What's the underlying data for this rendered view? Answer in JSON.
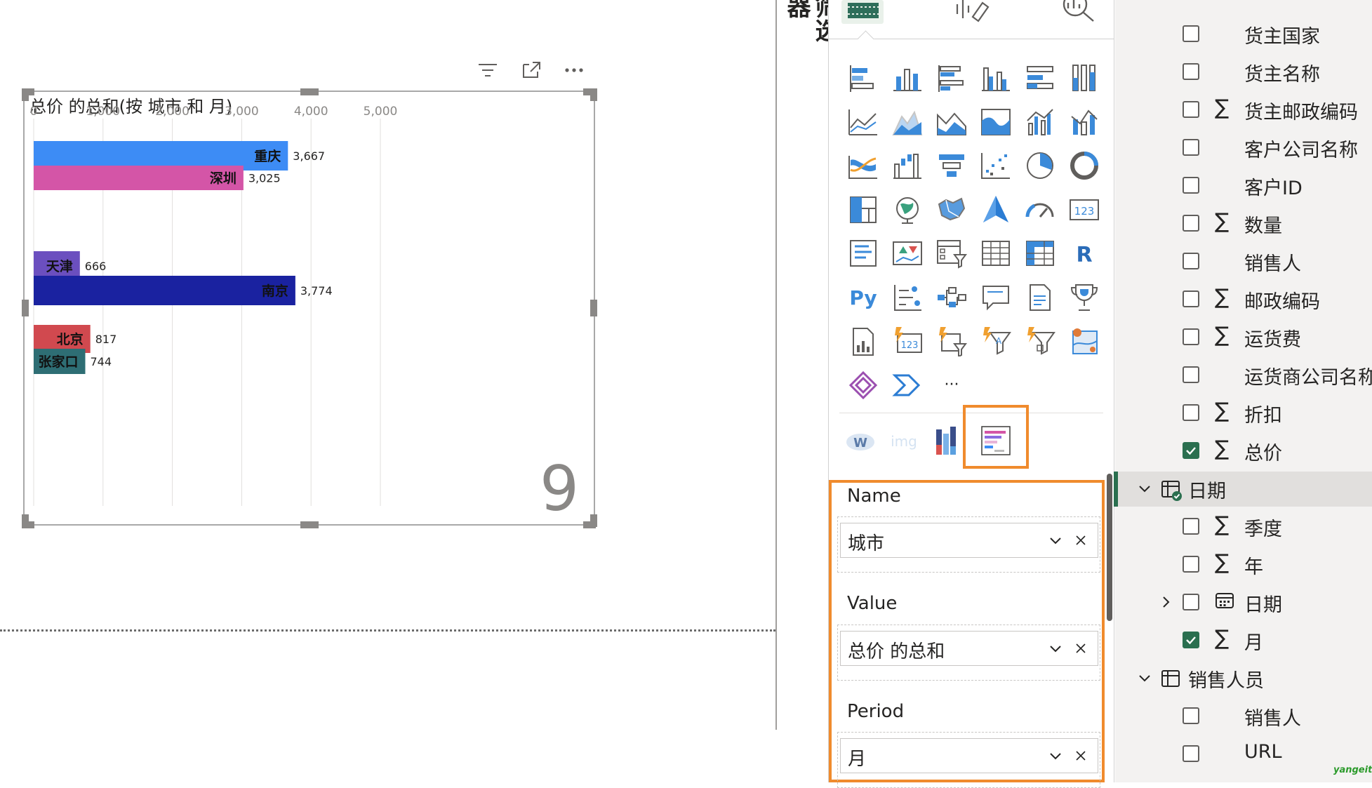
{
  "visual": {
    "title": "总价 的总和(按 城市 和 月)",
    "period_value": "9",
    "header_icons": [
      "filter-icon",
      "focus-mode-icon",
      "more-options-icon"
    ]
  },
  "chart_data": {
    "type": "bar",
    "orientation": "horizontal",
    "title": "总价 的总和(按 城市 和 月)",
    "xlabel": "",
    "ylabel": "",
    "xlim": [
      0,
      6000
    ],
    "x_ticks": [
      "0",
      "1,000",
      "2,000",
      "3,000",
      "4,000",
      "5,000"
    ],
    "grid": true,
    "categories": [
      "重庆",
      "深圳",
      "天津",
      "南京",
      "北京",
      "张家口"
    ],
    "values": [
      3667,
      3025,
      666,
      3774,
      817,
      744
    ],
    "value_labels": [
      "3,667",
      "3,025",
      "666",
      "3,774",
      "817",
      "744"
    ],
    "colors": [
      "#3d8cf5",
      "#d455a7",
      "#6b4fbf",
      "#1a22a0",
      "#d1494f",
      "#2e6e74"
    ],
    "period_label": "9"
  },
  "filters_tab": {
    "label": "筛选器"
  },
  "viz_pane": {
    "top_icons": [
      "build-visual-icon",
      "format-visual-icon",
      "analytics-icon"
    ],
    "icon_rows": [
      [
        "stacked-bar-chart-icon",
        "stacked-column-chart-icon",
        "clustered-bar-chart-icon",
        "clustered-column-chart-icon",
        "100-stacked-bar-chart-icon",
        "100-stacked-column-chart-icon"
      ],
      [
        "line-chart-icon",
        "area-chart-icon",
        "stacked-area-chart-icon",
        "100-stacked-area-chart-icon",
        "line-clustered-column-chart-icon",
        "line-stacked-column-chart-icon"
      ],
      [
        "ribbon-chart-icon",
        "waterfall-chart-icon",
        "funnel-chart-icon",
        "scatter-chart-icon",
        "pie-chart-icon",
        "donut-chart-icon"
      ],
      [
        "treemap-icon",
        "map-icon",
        "filled-map-icon",
        "azure-map-icon",
        "gauge-icon",
        "card-icon"
      ],
      [
        "multi-row-card-icon",
        "kpi-icon",
        "slicer-icon",
        "table-icon",
        "matrix-icon",
        "r-script-visual-icon"
      ],
      [
        "python-visual-icon",
        "key-influencers-icon",
        "decomposition-tree-icon",
        "qa-icon",
        "smart-narrative-icon",
        "metrics-icon"
      ],
      [
        "paginated-report-icon",
        "power-apps-card-icon",
        "power-apps-slicer-icon",
        "power-apps-text-filter-icon",
        "power-apps-filter-icon",
        "arcgis-map-icon"
      ],
      [
        "power-apps-icon",
        "power-automate-icon",
        "more-visuals-icon"
      ]
    ],
    "custom_visuals": [
      "word-cloud-icon",
      "image-visual-icon",
      "column-visual-icon",
      "bar-chart-race-icon"
    ],
    "custom_labels": {
      "word_cloud": "W",
      "image": "img"
    },
    "more_label": "···",
    "python_label": "Py",
    "r_label": "R",
    "card_label": "123",
    "wells": [
      {
        "label": "Name",
        "field": "城市"
      },
      {
        "label": "Value",
        "field": "总价 的总和"
      },
      {
        "label": "Period",
        "field": "月"
      }
    ]
  },
  "fields_pane": {
    "rows": [
      {
        "kind": "field",
        "label": "货主国家",
        "sigma": false,
        "checked": false
      },
      {
        "kind": "field",
        "label": "货主名称",
        "sigma": false,
        "checked": false
      },
      {
        "kind": "field",
        "label": "货主邮政编码",
        "sigma": true,
        "checked": false
      },
      {
        "kind": "field",
        "label": "客户公司名称",
        "sigma": false,
        "checked": false
      },
      {
        "kind": "field",
        "label": "客户ID",
        "sigma": false,
        "checked": false
      },
      {
        "kind": "field",
        "label": "数量",
        "sigma": true,
        "checked": false
      },
      {
        "kind": "field",
        "label": "销售人",
        "sigma": false,
        "checked": false
      },
      {
        "kind": "field",
        "label": "邮政编码",
        "sigma": true,
        "checked": false
      },
      {
        "kind": "field",
        "label": "运货费",
        "sigma": true,
        "checked": false
      },
      {
        "kind": "field",
        "label": "运货商公司名称",
        "sigma": false,
        "checked": false
      },
      {
        "kind": "field",
        "label": "折扣",
        "sigma": true,
        "checked": false
      },
      {
        "kind": "field",
        "label": "总价",
        "sigma": true,
        "checked": true
      },
      {
        "kind": "table",
        "label": "日期",
        "expanded": true,
        "in_use": true
      },
      {
        "kind": "field",
        "label": "季度",
        "sigma": true,
        "checked": false
      },
      {
        "kind": "field",
        "label": "年",
        "sigma": true,
        "checked": false
      },
      {
        "kind": "hierarchy",
        "label": "日期",
        "checked": false
      },
      {
        "kind": "field",
        "label": "月",
        "sigma": true,
        "checked": true
      },
      {
        "kind": "table",
        "label": "销售人员",
        "expanded": true,
        "in_use": false
      },
      {
        "kind": "field",
        "label": "销售人",
        "sigma": false,
        "checked": false
      },
      {
        "kind": "field",
        "label": "URL",
        "sigma": false,
        "checked": false
      }
    ],
    "sigma_glyph": "∑"
  },
  "watermark": "yangeit",
  "colors": {
    "accent_orange": "#f08b2d",
    "check_green": "#2a6f4f",
    "icon_blue": "#3b8ad9"
  }
}
